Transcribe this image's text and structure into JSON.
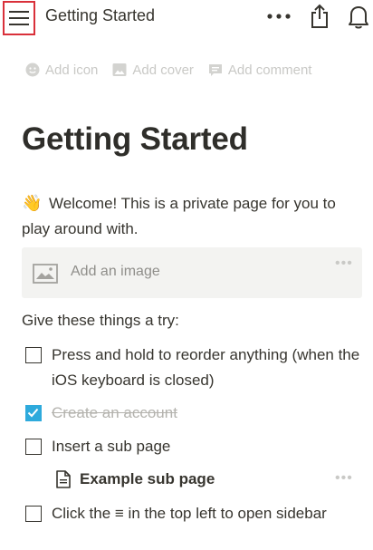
{
  "header": {
    "title": "Getting Started",
    "menu_icon": "hamburger-menu-icon",
    "more_icon": "more-horizontal-icon",
    "share_icon": "share-icon",
    "notifications_icon": "bell-icon"
  },
  "page_meta": {
    "add_icon_label": "Add icon",
    "add_cover_label": "Add cover",
    "add_comment_label": "Add comment"
  },
  "page": {
    "title": "Getting Started",
    "welcome_emoji": "👋",
    "welcome_text": "Welcome! This is a private page for you to play around with.",
    "image_placeholder": "Add an image",
    "try_label": "Give these things a try:"
  },
  "todos": [
    {
      "text": "Press and hold to reorder anything (when the iOS keyboard is closed)",
      "checked": false
    },
    {
      "text": "Create an account",
      "checked": true
    },
    {
      "text": "Insert a sub page",
      "checked": false
    },
    {
      "text": "Click the ≡ in the top left to open sidebar",
      "checked": false
    }
  ],
  "subpage": {
    "label": "Example sub page"
  },
  "colors": {
    "accent_check": "#2eaadc",
    "menu_highlight": "#d9303a",
    "text": "#37352f",
    "muted": "#c9c9c6"
  }
}
